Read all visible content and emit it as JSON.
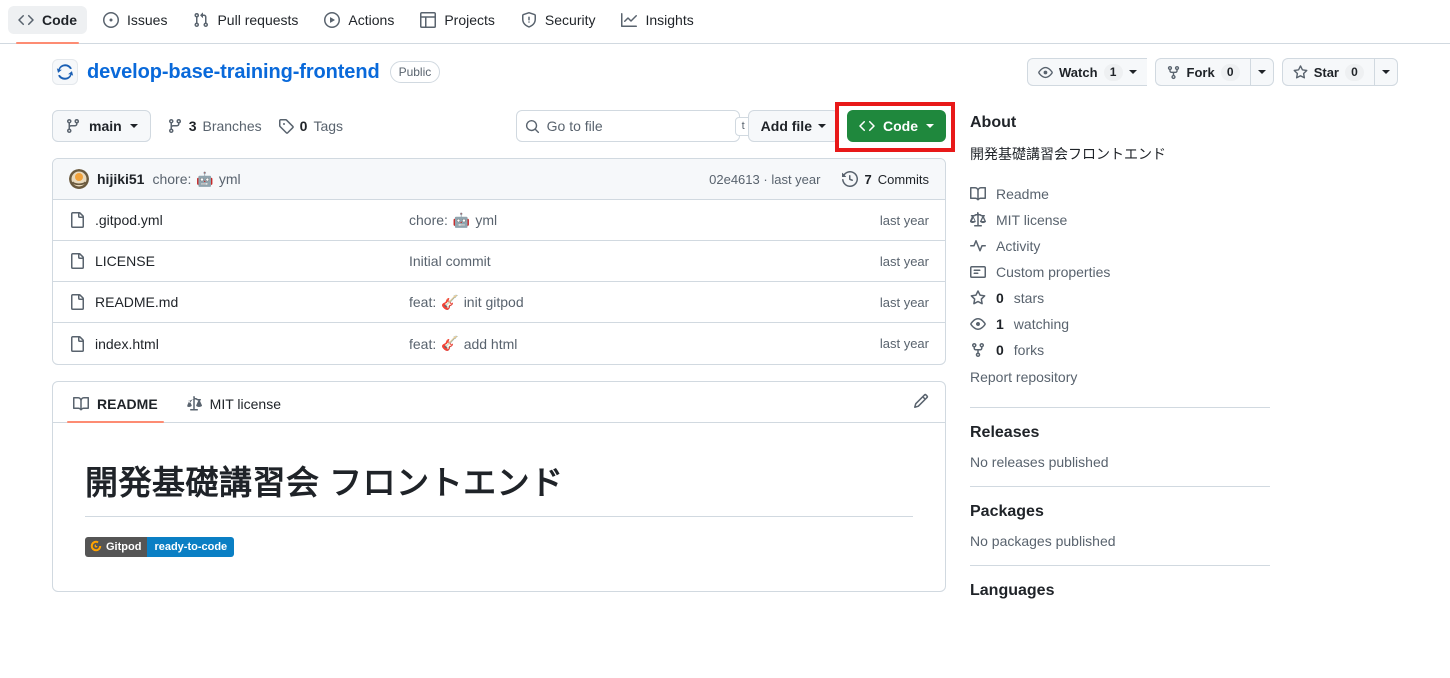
{
  "topnav": {
    "items": [
      {
        "label": "Code",
        "icon": "code-icon",
        "active": true
      },
      {
        "label": "Issues",
        "icon": "issue-opened-icon",
        "active": false
      },
      {
        "label": "Pull requests",
        "icon": "git-pull-request-icon",
        "active": false
      },
      {
        "label": "Actions",
        "icon": "play-icon",
        "active": false
      },
      {
        "label": "Projects",
        "icon": "table-icon",
        "active": false
      },
      {
        "label": "Security",
        "icon": "shield-icon",
        "active": false
      },
      {
        "label": "Insights",
        "icon": "graph-icon",
        "active": false
      }
    ]
  },
  "repo": {
    "avatar_icon": "repo-avatar-icon",
    "name": "develop-base-training-frontend",
    "visibility": "Public",
    "watch": {
      "label": "Watch",
      "count": "1",
      "icon": "eye-icon"
    },
    "fork": {
      "label": "Fork",
      "count": "0",
      "icon": "repo-forked-icon"
    },
    "star": {
      "label": "Star",
      "count": "0",
      "icon": "star-icon"
    }
  },
  "filebar": {
    "branch": "main",
    "branches_count": "3",
    "branches_label": "Branches",
    "tags_count": "0",
    "tags_label": "Tags",
    "search_placeholder": "Go to file",
    "search_value": "",
    "search_kbd": "t",
    "add_file_label": "Add file",
    "code_label": "Code",
    "annotation_color": "#e81919"
  },
  "commit": {
    "author": "hijiki51",
    "message_prefix": "chore:",
    "message_emoji": "🤖",
    "message_suffix": "yml",
    "sha": "02e4613",
    "sha_separator": "·",
    "time": "last year",
    "commits_count": "7",
    "commits_label": "Commits"
  },
  "files": {
    "time_header": "",
    "rows": [
      {
        "name": ".gitpod.yml",
        "icon": "file-icon",
        "msg_prefix": "chore:",
        "emoji": "🤖",
        "msg_suffix": "yml",
        "time": "last year"
      },
      {
        "name": "LICENSE",
        "icon": "file-icon",
        "msg_prefix": "Initial commit",
        "emoji": "",
        "msg_suffix": "",
        "time": "last year"
      },
      {
        "name": "README.md",
        "icon": "file-icon",
        "msg_prefix": "feat:",
        "emoji": "🎸",
        "msg_suffix": "init gitpod",
        "time": "last year"
      },
      {
        "name": "index.html",
        "icon": "file-icon",
        "msg_prefix": "feat:",
        "emoji": "🎸",
        "msg_suffix": "add html",
        "time": "last year"
      }
    ]
  },
  "readme": {
    "tabs": [
      {
        "label": "README",
        "icon": "book-icon",
        "active": true
      },
      {
        "label": "MIT license",
        "icon": "law-icon",
        "active": false
      }
    ],
    "edit_icon": "pencil-icon",
    "heading": "開発基礎講習会 フロントエンド",
    "badge": {
      "left": "Gitpod",
      "right": "ready-to-code",
      "left_bg": "#555555",
      "right_bg": "#0a7fc4",
      "logo_color": "#ffa300"
    }
  },
  "sidebar": {
    "about_title": "About",
    "description": "開発基礎講習会フロントエンド",
    "links": [
      {
        "label": "Readme",
        "icon": "book-icon"
      },
      {
        "label": "MIT license",
        "icon": "law-icon"
      },
      {
        "label": "Activity",
        "icon": "pulse-icon"
      },
      {
        "label": "Custom properties",
        "icon": "note-icon"
      }
    ],
    "stats": [
      {
        "value": "0",
        "label": "stars",
        "icon": "star-icon"
      },
      {
        "value": "1",
        "label": "watching",
        "icon": "eye-icon"
      },
      {
        "value": "0",
        "label": "forks",
        "icon": "repo-forked-icon"
      }
    ],
    "report_link": "Report repository",
    "releases_title": "Releases",
    "releases_empty": "No releases published",
    "packages_title": "Packages",
    "packages_empty": "No packages published",
    "languages_title": "Languages"
  }
}
